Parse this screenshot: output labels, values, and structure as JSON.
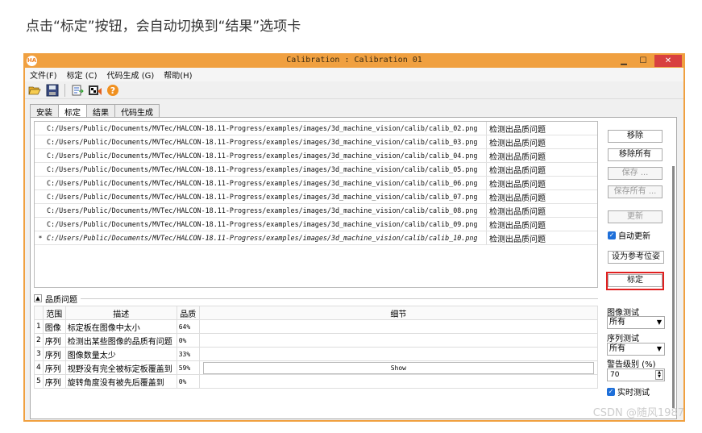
{
  "caption": "点击“标定”按钮，会自动切换到“结果”选项卡",
  "window": {
    "title": "Calibration : Calibration 01",
    "app_icon": "HA",
    "controls": {
      "minimize": "▁",
      "maximize": "☐",
      "close": "✕"
    }
  },
  "menu": [
    "文件(F)",
    "标定 (C)",
    "代码生成 (G)",
    "帮助(H)"
  ],
  "toolbar": [
    "open-folder-icon",
    "save-icon",
    "export-icon",
    "camera-icon",
    "help-icon"
  ],
  "tabs": [
    "安装",
    "标定",
    "结果",
    "代码生成"
  ],
  "active_tab": "标定",
  "files": [
    {
      "marker": "",
      "path": "C:/Users/Public/Documents/MVTec/HALCON-18.11-Progress/examples/images/3d_machine_vision/calib/calib_02.png",
      "quality": "检测出品质问题"
    },
    {
      "marker": "",
      "path": "C:/Users/Public/Documents/MVTec/HALCON-18.11-Progress/examples/images/3d_machine_vision/calib/calib_03.png",
      "quality": "检测出品质问题"
    },
    {
      "marker": "",
      "path": "C:/Users/Public/Documents/MVTec/HALCON-18.11-Progress/examples/images/3d_machine_vision/calib/calib_04.png",
      "quality": "检测出品质问题"
    },
    {
      "marker": "",
      "path": "C:/Users/Public/Documents/MVTec/HALCON-18.11-Progress/examples/images/3d_machine_vision/calib/calib_05.png",
      "quality": "检测出品质问题"
    },
    {
      "marker": "",
      "path": "C:/Users/Public/Documents/MVTec/HALCON-18.11-Progress/examples/images/3d_machine_vision/calib/calib_06.png",
      "quality": "检测出品质问题"
    },
    {
      "marker": "",
      "path": "C:/Users/Public/Documents/MVTec/HALCON-18.11-Progress/examples/images/3d_machine_vision/calib/calib_07.png",
      "quality": "检测出品质问题"
    },
    {
      "marker": "",
      "path": "C:/Users/Public/Documents/MVTec/HALCON-18.11-Progress/examples/images/3d_machine_vision/calib/calib_08.png",
      "quality": "检测出品质问题"
    },
    {
      "marker": "",
      "path": "C:/Users/Public/Documents/MVTec/HALCON-18.11-Progress/examples/images/3d_machine_vision/calib/calib_09.png",
      "quality": "检测出品质问题"
    },
    {
      "marker": "*",
      "path": "C:/Users/Public/Documents/MVTec/HALCON-18.11-Progress/examples/images/3d_machine_vision/calib/calib_10.png",
      "quality": "检测出品质问题"
    }
  ],
  "side_buttons": {
    "remove": "移除",
    "remove_all": "移除所有",
    "save": "保存 ...",
    "save_all": "保存所有 ...",
    "update": "更新",
    "auto_update": "自动更新",
    "set_reference": "设为参考位姿",
    "calibrate": "标定"
  },
  "quality": {
    "section_title": "品质问题",
    "headers": [
      "范围",
      "描述",
      "品质",
      "细节"
    ],
    "rows": [
      {
        "idx": "1",
        "scope": "图像",
        "desc": "标定板在图像中太小",
        "pct": "64%",
        "detail": ""
      },
      {
        "idx": "2",
        "scope": "序列",
        "desc": "检测出某些图像的品质有问题",
        "pct": "0%",
        "detail": ""
      },
      {
        "idx": "3",
        "scope": "序列",
        "desc": "图像数量太少",
        "pct": "33%",
        "detail": ""
      },
      {
        "idx": "4",
        "scope": "序列",
        "desc": "视野没有完全被标定板覆盖到",
        "pct": "59%",
        "detail": "Show"
      },
      {
        "idx": "5",
        "scope": "序列",
        "desc": "旋转角度没有被先后覆盖到",
        "pct": "0%",
        "detail": ""
      }
    ],
    "image_test_label": "图像测试",
    "image_test_value": "所有",
    "sequence_test_label": "序列测试",
    "sequence_test_value": "所有",
    "warning_level_label": "警告级别 (%)",
    "warning_level_value": "70",
    "realtime_test": "实时测试"
  },
  "watermark": "CSDN @随风1987"
}
